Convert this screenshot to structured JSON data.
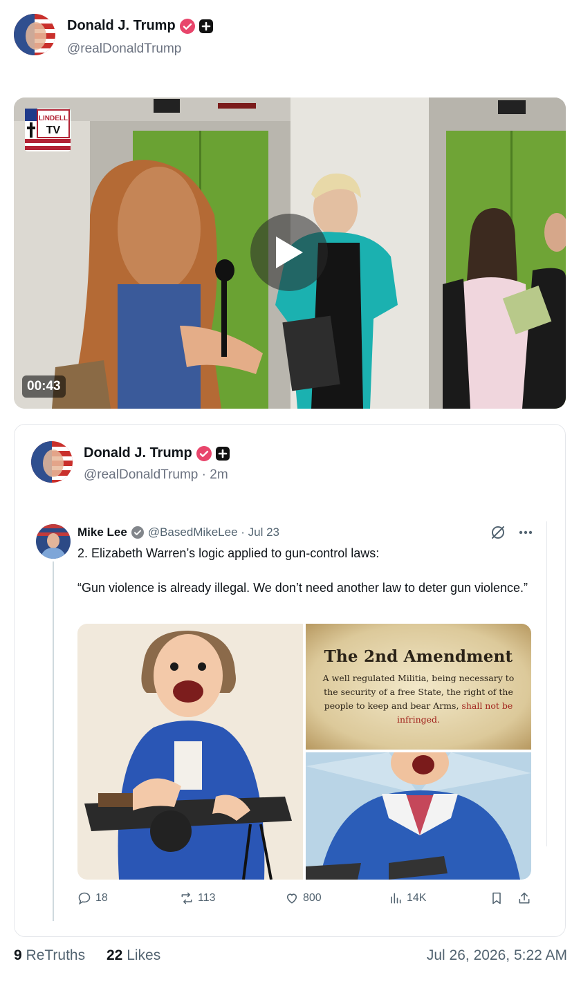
{
  "post": {
    "author_name": "Donald J. Trump",
    "author_handle": "@realDonaldTrump",
    "video_duration": "00:43",
    "video_logo": "LINDELL TV"
  },
  "retruth": {
    "author_name": "Donald J. Trump",
    "author_handle": "@realDonaldTrump · 2m"
  },
  "tweet": {
    "author_name": "Mike Lee",
    "author_handle": "@BasedMikeLee · Jul 23",
    "text_line1": "2. Elizabeth Warren’s logic applied to gun-control laws:",
    "text_line2": "“Gun violence is already illegal. We don’t need another law to deter gun violence.”",
    "amendment_title": "The 2nd Amendment",
    "amendment_body": "A well regulated Militia, being necessary to the security of a free State, the right of the people to keep and bear Arms, ",
    "amendment_emphasis": "shall not be infringed.",
    "stats": {
      "replies": "18",
      "reposts": "113",
      "likes": "800",
      "views": "14K"
    }
  },
  "footer": {
    "retruths_count": "9",
    "retruths_label": "ReTruths",
    "likes_count": "22",
    "likes_label": "Likes",
    "timestamp": "Jul 26, 2026, 5:22 AM"
  },
  "colors": {
    "verified_badge": "#e8456b",
    "text_primary": "#0f1419",
    "text_secondary": "#536471"
  }
}
